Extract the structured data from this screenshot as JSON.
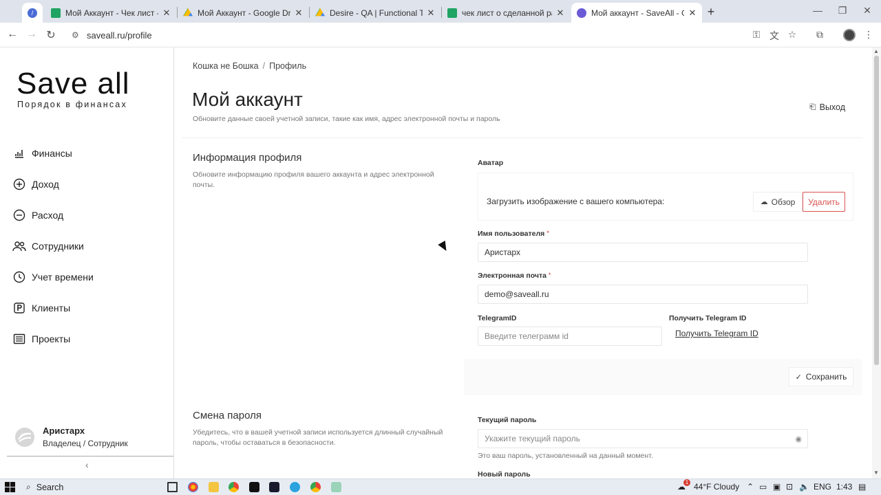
{
  "browser": {
    "tabs": [
      {
        "title": "Мой Аккаунт - Чек лист - Goo",
        "color": "#1fa463"
      },
      {
        "title": "Мой Аккаунт - Google Drive",
        "color": "#4285f4"
      },
      {
        "title": "Desire - QA | Functional Testing",
        "color": "#4285f4"
      },
      {
        "title": "чек лист о сделанной работе",
        "color": "#1fa463"
      },
      {
        "title": "Мой аккаунт - SaveAll - Googl",
        "color": "#6b5bd6"
      }
    ],
    "url": "saveall.ru/profile"
  },
  "sidebar": {
    "logo_title": "Save all",
    "logo_subtitle": "Порядок в финансах",
    "items": [
      {
        "label": "Финансы",
        "icon": "chart-icon"
      },
      {
        "label": "Доход",
        "icon": "plus-circle-icon"
      },
      {
        "label": "Расход",
        "icon": "minus-circle-icon"
      },
      {
        "label": "Сотрудники",
        "icon": "users-icon"
      },
      {
        "label": "Учет времени",
        "icon": "clock-icon"
      },
      {
        "label": "Клиенты",
        "icon": "p-square-icon"
      },
      {
        "label": "Проекты",
        "icon": "list-icon"
      }
    ],
    "user_name": "Аристарх",
    "user_role": "Владелец / Сотрудник"
  },
  "main": {
    "breadcrumb": [
      "Кошка не Бошка",
      "Профиль"
    ],
    "title": "Мой аккаунт",
    "description": "Обновите данные своей учетной записи, такие как имя, адрес электронной почты и пароль",
    "logout_label": "Выход",
    "profile": {
      "title": "Информация профиля",
      "description": "Обновите информацию профиля вашего аккаунта и адрес электронной почты.",
      "avatar_label": "Аватар",
      "avatar_text": "Загрузить изображение с вашего компьютера:",
      "browse_label": "Обзор",
      "delete_label": "Удалить",
      "username_label": "Имя пользователя",
      "username_value": "Аристарх",
      "email_label": "Электронная почта",
      "email_value": "demo@saveall.ru",
      "telegram_label": "TelegramID",
      "telegram_placeholder": "Введите телеграмм id",
      "get_telegram_label": "Получить Telegram ID",
      "get_telegram_link": "Получить Telegram ID",
      "save_label": "Сохранить"
    },
    "password": {
      "title": "Смена пароля",
      "description": "Убедитесь, что в вашей учетной записи используется длинный случайный пароль, чтобы оставаться в безопасности.",
      "current_label": "Текущий пароль",
      "current_placeholder": "Укажите текущий пароль",
      "current_note": "Это ваш пароль, установленный на данный момент.",
      "new_label": "Новый пароль"
    }
  },
  "taskbar": {
    "search_label": "Search",
    "weather": "44°F  Cloudy",
    "lang": "ENG",
    "time": "1:43",
    "notification_count": "1"
  }
}
